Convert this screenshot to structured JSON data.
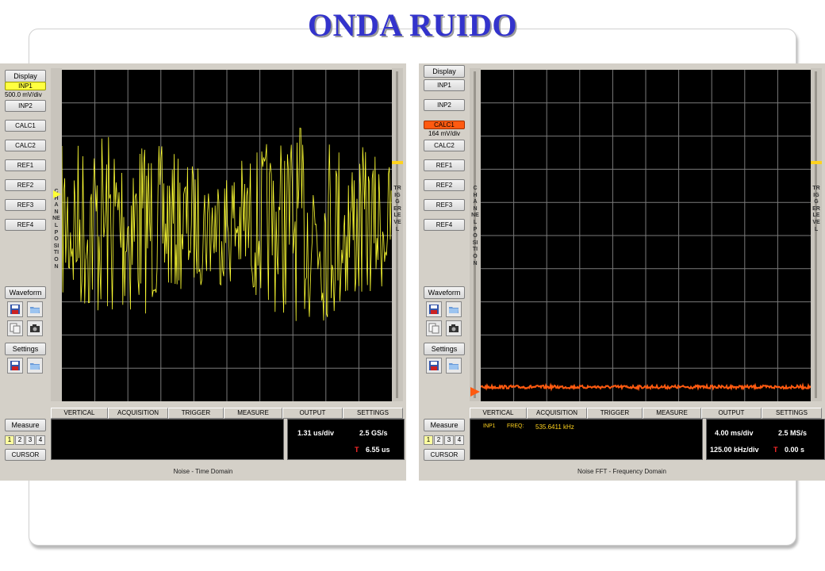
{
  "slide": {
    "title": "ONDA RUIDO"
  },
  "colors": {
    "title": "#3333cc",
    "trace_time": "#ffff33",
    "trace_fft": "#ff5a10",
    "grid": "#7a7a7a"
  },
  "left_scope": {
    "display_label": "Display",
    "channels": [
      "INP1",
      "INP2",
      "CALC1",
      "CALC2",
      "REF1",
      "REF2",
      "REF3",
      "REF4"
    ],
    "active_channel": "INP1",
    "active_scale": "500.0 mV/div",
    "waveform_label": "Waveform",
    "settings_label": "Settings",
    "measure_label": "Measure",
    "pages": [
      "1",
      "2",
      "3",
      "4"
    ],
    "cursor_label": "CURSOR",
    "channel_position_label": "CHANNEL POSITION",
    "trigger_level_label": "TRIGGER LEVEL",
    "menu": [
      "VERTICAL",
      "ACQUISITION",
      "TRIGGER",
      "MEASURE",
      "OUTPUT",
      "SETTINGS"
    ],
    "timebase": "1.31 us/div",
    "sample_rate": "2.5 GS/s",
    "trigger_marker": "T",
    "trigger_time": "6.55 us",
    "caption": "Noise - Time Domain"
  },
  "right_scope": {
    "display_label": "Display",
    "channels": [
      "INP1",
      "INP2",
      "CALC1",
      "CALC2",
      "REF1",
      "REF2",
      "REF3",
      "REF4"
    ],
    "active_channel": "CALC1",
    "active_scale": "164 mV/div",
    "waveform_label": "Waveform",
    "settings_label": "Settings",
    "measure_label": "Measure",
    "pages": [
      "1",
      "2",
      "3",
      "4"
    ],
    "cursor_label": "CURSOR",
    "channel_position_label": "CHANNEL POSITION",
    "trigger_level_label": "TRIGGER LEVEL",
    "menu": [
      "VERTICAL",
      "ACQUISITION",
      "TRIGGER",
      "MEASURE",
      "OUTPUT",
      "SETTINGS"
    ],
    "meas_source": "INP1",
    "meas_name": "FREQ:",
    "meas_value": "535.6411 kHz",
    "timebase": "4.00 ms/div",
    "sample_rate": "2.5 MS/s",
    "freq_div": "125.00 kHz/div",
    "trigger_marker": "T",
    "trigger_time": "0.00 s",
    "caption": "Noise FFT - Frequency Domain"
  },
  "icons": [
    "save-icon",
    "open-folder-icon",
    "copy-icon",
    "camera-icon"
  ]
}
